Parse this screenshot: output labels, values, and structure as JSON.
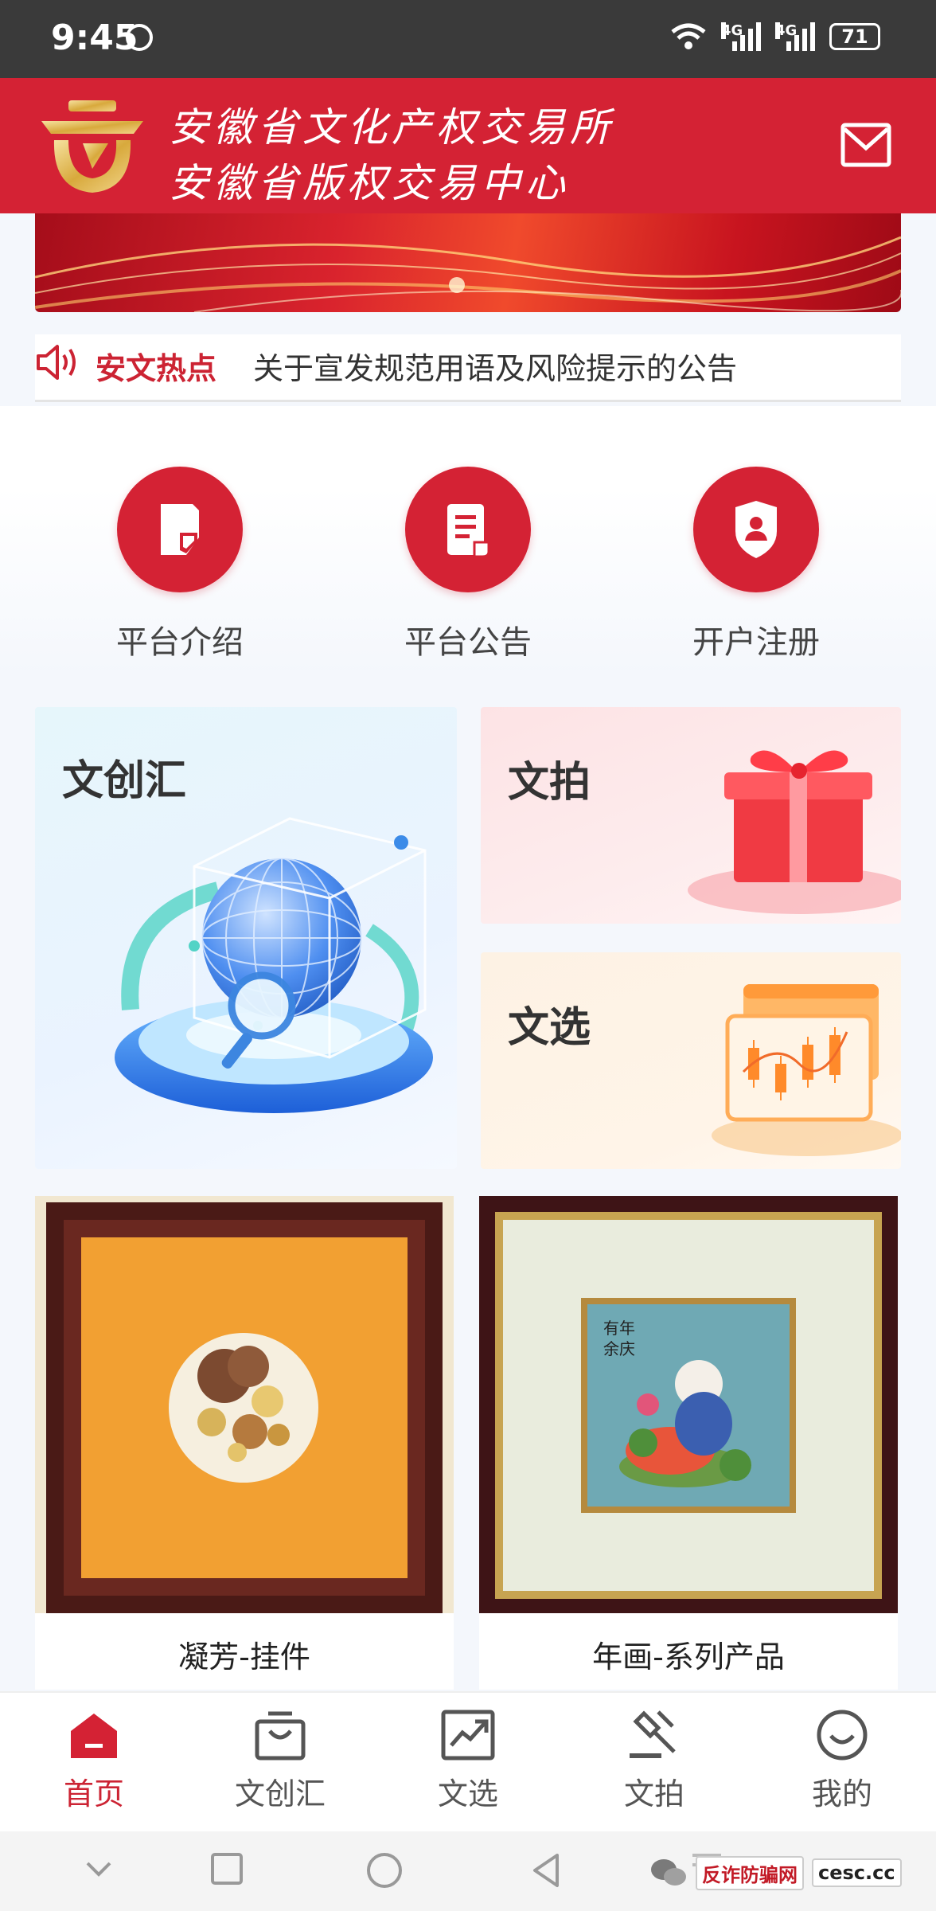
{
  "status_bar": {
    "time": "9:45",
    "network_1": "4G",
    "network_2": "4G",
    "battery": "71"
  },
  "header": {
    "org_name_1": "安徽省文化产权交易所",
    "org_name_2": "安徽省版权交易中心",
    "mail_icon": "mail-icon",
    "brand_color": "#d42234"
  },
  "notice": {
    "tag": "安文热点",
    "text": "关于宣发规范用语及风险提示的公告",
    "icon": "speaker-icon"
  },
  "quick_links": [
    {
      "label": "平台介绍",
      "icon": "document-icon"
    },
    {
      "label": "平台公告",
      "icon": "notice-doc-icon"
    },
    {
      "label": "开户注册",
      "icon": "user-shield-icon"
    }
  ],
  "cards": {
    "wenchuang": {
      "title": "文创汇",
      "icon": "globe-illustration"
    },
    "wenpai": {
      "title": "文拍",
      "icon": "gift-box-illustration"
    },
    "wenxuan": {
      "title": "文选",
      "icon": "candlestick-chart-illustration"
    }
  },
  "products": [
    {
      "caption": "凝芳-挂件"
    },
    {
      "caption": "年画-系列产品",
      "art_text_1": "有年",
      "art_text_2": "余庆"
    }
  ],
  "bottom_nav": [
    {
      "label": "首页",
      "icon": "home-icon",
      "active": true
    },
    {
      "label": "文创汇",
      "icon": "shopping-bag-icon",
      "active": false
    },
    {
      "label": "文选",
      "icon": "trend-chart-icon",
      "active": false
    },
    {
      "label": "文拍",
      "icon": "auction-hammer-icon",
      "active": false
    },
    {
      "label": "我的",
      "icon": "smile-icon",
      "active": false
    }
  ],
  "watermark": {
    "text_1": "反诈防骗网",
    "text_2": "cesc.cc"
  }
}
